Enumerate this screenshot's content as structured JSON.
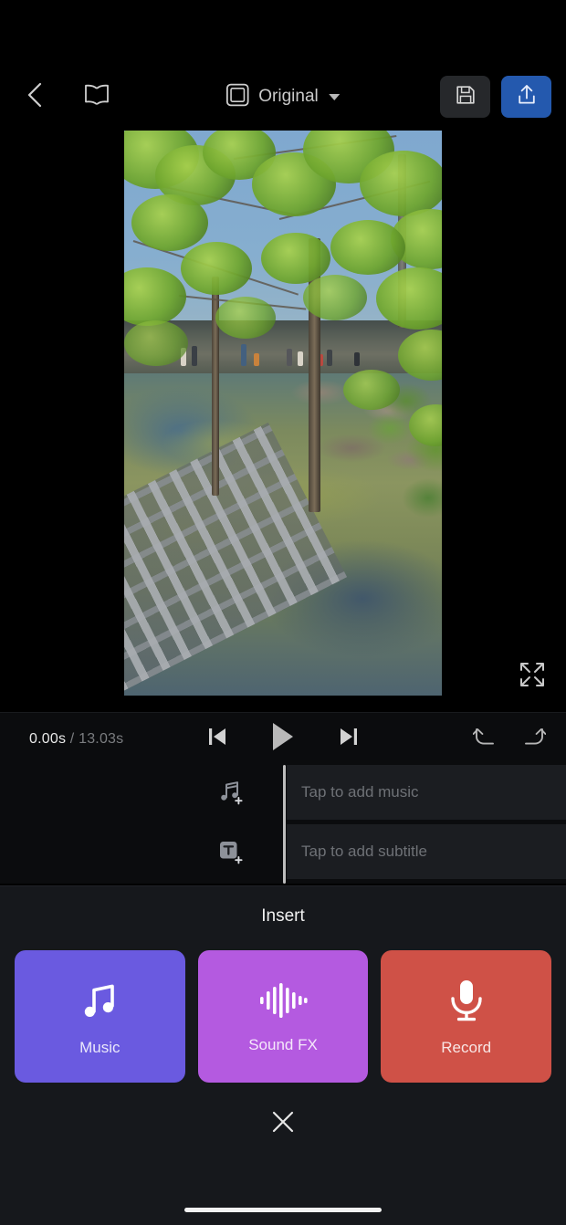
{
  "app": {
    "theme_background": "#000000",
    "sheet_background": "#16181c"
  },
  "topbar": {
    "back_icon": "chevron-left-icon",
    "tutorial_icon": "book-icon",
    "aspect_icon": "aspect-ratio-square-icon",
    "aspect_label": "Original",
    "caret_icon": "chevron-down-icon",
    "save_icon": "floppy-disk-icon",
    "save_button_color": "#26282b",
    "export_icon": "upload-arrow-icon",
    "export_button_color": "#2459ae"
  },
  "preview": {
    "expand_icon": "fullscreen-expand-icon",
    "scene_description": "Outdoor park scene with green leafy trees, a wooden boardwalk with visitors, algae covered water with alligators, and a metal grate walkway in the foreground"
  },
  "transport": {
    "current_time": "0.00s",
    "separator": "/",
    "total_time": "13.03s",
    "prev_frame_icon": "skip-previous-icon",
    "play_icon": "play-icon",
    "next_frame_icon": "skip-next-icon",
    "undo_icon": "undo-icon",
    "redo_icon": "redo-icon"
  },
  "timeline": {
    "tracks": [
      {
        "icon": "add-music-icon",
        "hint": "Tap to add music"
      },
      {
        "icon": "add-text-icon",
        "hint": "Tap to add subtitle"
      }
    ]
  },
  "sheet": {
    "title": "Insert",
    "cards": [
      {
        "label": "Music",
        "icon": "music-note-icon",
        "color": "#6a5ae0"
      },
      {
        "label": "Sound FX",
        "icon": "waveform-icon",
        "color": "#b45ae0"
      },
      {
        "label": "Record",
        "icon": "microphone-icon",
        "color": "#cf5147"
      }
    ],
    "close_icon": "close-x-icon"
  }
}
